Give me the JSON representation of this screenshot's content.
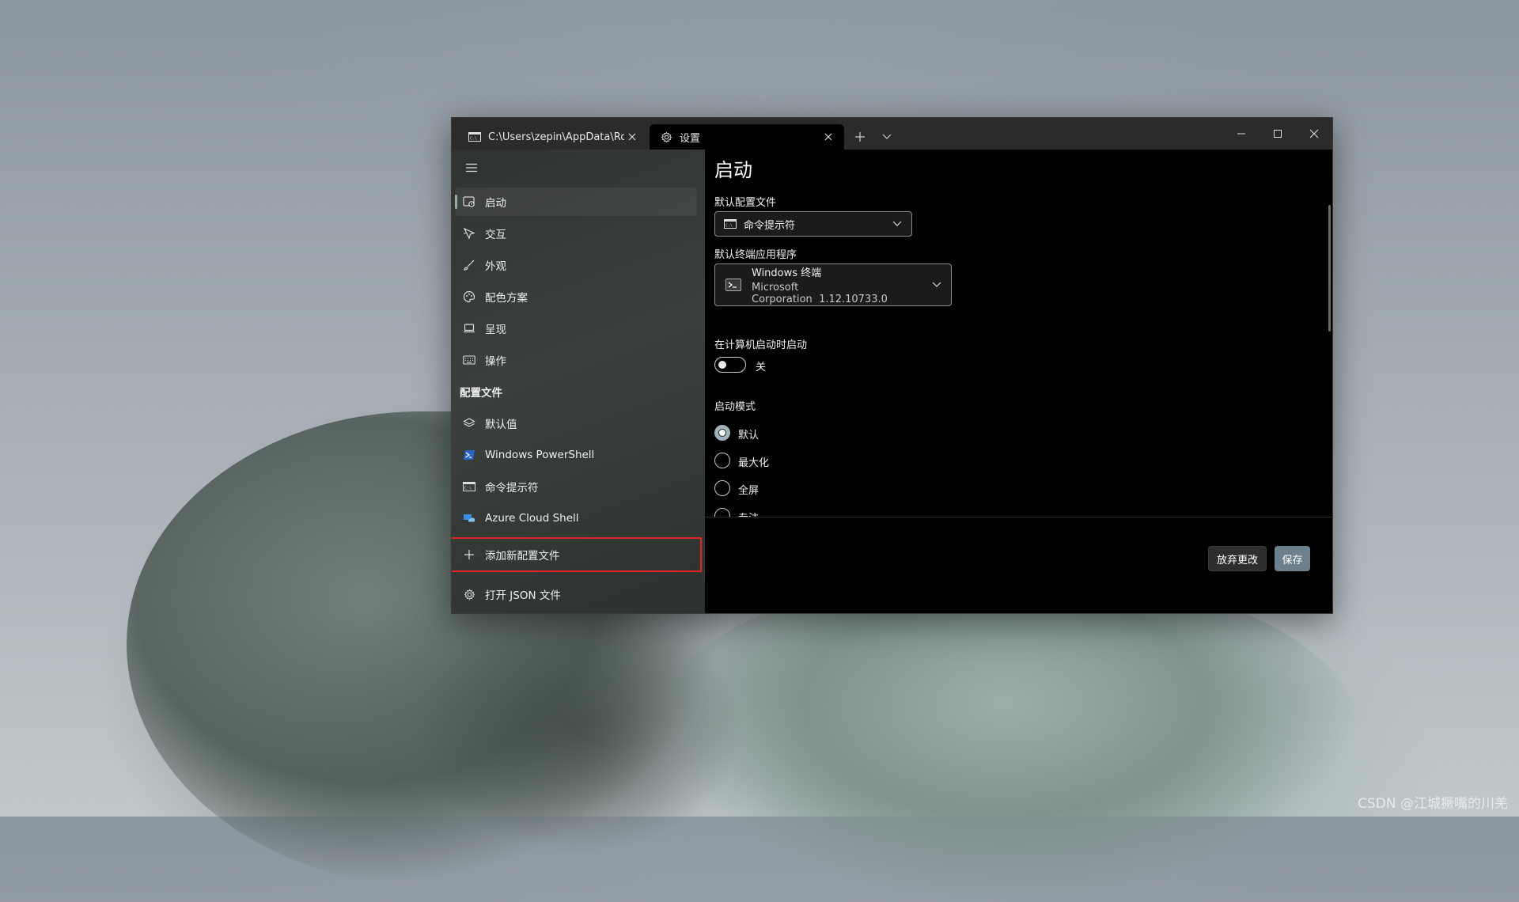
{
  "window": {
    "tabs": [
      {
        "label": "C:\\Users\\zepin\\AppData\\Roami",
        "icon": "cmd-icon"
      },
      {
        "label": "设置",
        "icon": "gear-icon"
      }
    ]
  },
  "sidebar": {
    "items": [
      {
        "label": "启动",
        "icon": "launch-icon"
      },
      {
        "label": "交互",
        "icon": "interaction-icon"
      },
      {
        "label": "外观",
        "icon": "brush-icon"
      },
      {
        "label": "配色方案",
        "icon": "palette-icon"
      },
      {
        "label": "呈现",
        "icon": "laptop-icon"
      },
      {
        "label": "操作",
        "icon": "keyboard-icon"
      }
    ],
    "profiles_header": "配置文件",
    "profiles": [
      {
        "label": "默认值",
        "icon": "layers-icon"
      },
      {
        "label": "Windows PowerShell",
        "icon": "powershell-icon"
      },
      {
        "label": "命令提示符",
        "icon": "cmd-icon"
      },
      {
        "label": "Azure Cloud Shell",
        "icon": "azure-icon"
      }
    ],
    "add_profile": "添加新配置文件",
    "open_json": "打开 JSON 文件"
  },
  "content": {
    "title": "启动",
    "default_profile_label": "默认配置文件",
    "default_profile_value": "命令提示符",
    "default_terminal_label": "默认终端应用程序",
    "default_terminal_name": "Windows 终端",
    "default_terminal_publisher": "Microsoft Corporation",
    "default_terminal_version": "1.12.10733.0",
    "launch_on_startup_label": "在计算机启动时启动",
    "launch_on_startup_value": "关",
    "launch_mode_label": "启动模式",
    "launch_modes": [
      "默认",
      "最大化",
      "全屏",
      "专注"
    ],
    "selected_launch_mode": "默认"
  },
  "footer": {
    "discard_label": "放弃更改",
    "save_label": "保存"
  },
  "watermark": "CSDN @江城撅嘴的川羌",
  "colors": {
    "accent": "#9fb1bb",
    "save_button": "#6b7f8c",
    "highlight_box": "#e0262b"
  }
}
